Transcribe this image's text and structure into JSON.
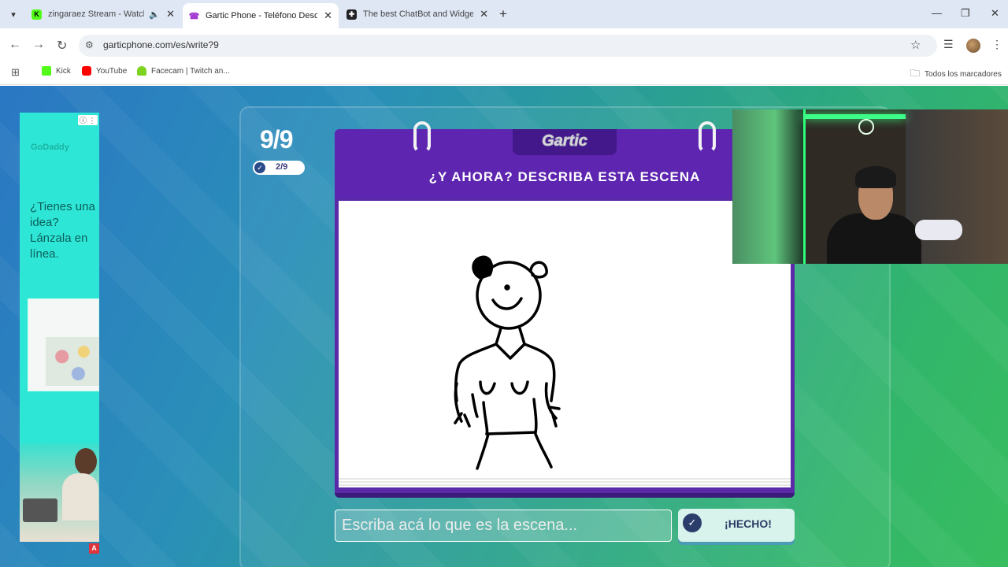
{
  "browser": {
    "tabs": [
      {
        "title": "zingaraez Stream - Watch Li",
        "favicon_color": "#53fc18",
        "favicon_letter": "K",
        "audio": true
      },
      {
        "title": "Gartic Phone - Teléfono Descon",
        "favicon_color": "#a33bd1",
        "favicon_letter": "☎",
        "active": true
      },
      {
        "title": "The best ChatBot and Widgets",
        "favicon_color": "#222222",
        "favicon_letter": "✚"
      }
    ],
    "url": "garticphone.com/es/write?9",
    "bookmarks": [
      {
        "label": "Kick",
        "color": "#53fc18"
      },
      {
        "label": "YouTube",
        "color": "#ff0000"
      },
      {
        "label": "Facecam | Twitch an...",
        "color": "#7ed321"
      }
    ],
    "all_bookmarks": "Todos los marcadores"
  },
  "ad": {
    "brand": "GoDaddy",
    "headline": "¿Tienes una idea? Lánzala en línea.",
    "badge": "A"
  },
  "game": {
    "round": "9/9",
    "done_count": "2/9",
    "logo": "Gartic",
    "prompt": "¿Y AHORA? DESCRIBA ESTA ESCENA",
    "input_placeholder": "Escriba acá lo que es la escena...",
    "done_label": "¡HECHO!"
  },
  "colors": {
    "notebook": "#5a2aa8",
    "accent_green": "#38bd5f",
    "accent_blue": "#2a77c3"
  },
  "icons": {
    "sound": "speaker-icon",
    "theme": "half-moon-icon",
    "done": "check-icon"
  }
}
